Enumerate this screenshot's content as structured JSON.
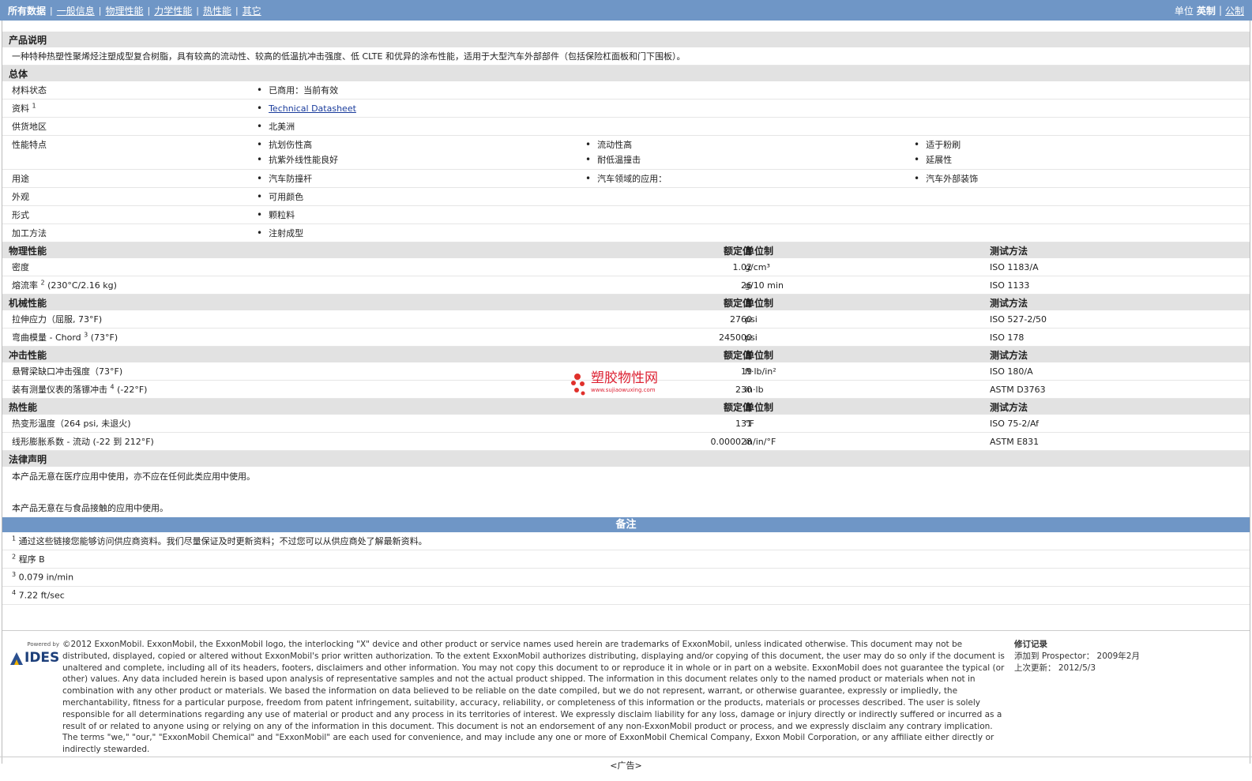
{
  "topbar": {
    "tabs": [
      "所有数据",
      "一般信息",
      "物理性能",
      "力学性能",
      "热性能",
      "其它"
    ],
    "unit_label": "单位",
    "unit_current": "英制",
    "unit_other": "公制"
  },
  "description": {
    "title": "产品说明",
    "text": "一种特种热塑性聚烯烃注塑成型复合树脂，具有较高的流动性、较高的低温抗冲击强度、低 CLTE 和优异的涂布性能，适用于大型汽车外部部件（包括保险杠面板和门下围板）。"
  },
  "general": {
    "title": "总体",
    "rows": [
      {
        "label": "材料状态",
        "items": [
          "已商用：当前有效"
        ]
      },
      {
        "label": "资料",
        "sup": "1",
        "items": [
          "Technical Datasheet"
        ]
      },
      {
        "label": "供货地区",
        "items": [
          "北美洲"
        ]
      },
      {
        "label": "性能特点",
        "items": [
          "抗划伤性高",
          "流动性高",
          "适于粉刷",
          "抗紫外线性能良好",
          "耐低温撞击",
          "延展性"
        ]
      },
      {
        "label": "用途",
        "items": [
          "汽车防撞杆",
          "汽车领域的应用：",
          "汽车外部装饰"
        ]
      },
      {
        "label": "外观",
        "items": [
          "可用颜色"
        ]
      },
      {
        "label": "形式",
        "items": [
          "颗粒料"
        ]
      },
      {
        "label": "加工方法",
        "items": [
          "注射成型"
        ]
      }
    ]
  },
  "headers": {
    "value": "额定值",
    "unit": "单位制",
    "test": "测试方法"
  },
  "physical": {
    "title": "物理性能",
    "rows": [
      {
        "name": "密度",
        "value": "1.02",
        "unit": "g/cm³",
        "test": "ISO 1183/A"
      },
      {
        "name": "熔流率",
        "sup": "2",
        "cond": " (230°C/2.16 kg)",
        "value": "26",
        "unit": "g/10 min",
        "test": "ISO 1133"
      }
    ]
  },
  "mechanical": {
    "title": "机械性能",
    "rows": [
      {
        "name": "拉伸应力（屈服, 73°F)",
        "value": "2760",
        "unit": "psi",
        "test": "ISO 527-2/50"
      },
      {
        "name": "弯曲模量 - Chord",
        "sup": "3",
        "cond": " (73°F)",
        "value": "245000",
        "unit": "psi",
        "test": "ISO 178"
      }
    ]
  },
  "impact": {
    "title": "冲击性能",
    "rows": [
      {
        "name": "悬臂梁缺口冲击强度（73°F)",
        "value": "19",
        "unit": "ft·lb/in²",
        "test": "ISO 180/A"
      },
      {
        "name": "装有测量仪表的落镖冲击",
        "sup": "4",
        "cond": " (-22°F)",
        "value": "230",
        "unit": "in·lb",
        "test": "ASTM D3763"
      }
    ]
  },
  "thermal": {
    "title": "热性能",
    "rows": [
      {
        "name": "热变形温度（264 psi, 未退火)",
        "value": "131",
        "unit": "°F",
        "test": "ISO 75-2/Af"
      },
      {
        "name": "线形膨胀系数 - 流动 (-22 到 212°F)",
        "value": "0.000028",
        "unit": "in/in/°F",
        "test": "ASTM E831"
      }
    ]
  },
  "legal": {
    "title": "法律声明",
    "p1": "本产品无意在医疗应用中使用，亦不应在任何此类应用中使用。",
    "p2": "本产品无意在与食品接触的应用中使用。"
  },
  "notes": {
    "title": "备注",
    "items": [
      {
        "n": "1",
        "text": "通过这些链接您能够访问供应商资料。我们尽量保证及时更新资料；不过您可以从供应商处了解最新资料。"
      },
      {
        "n": "2",
        "text": "程序 B"
      },
      {
        "n": "3",
        "text": "0.079 in/min"
      },
      {
        "n": "4",
        "text": "7.22 ft/sec"
      }
    ]
  },
  "footer": {
    "logo_top": "Powered by",
    "logo_text": "IDES",
    "copyright": "©2012 ExxonMobil. ExxonMobil, the ExxonMobil logo, the interlocking \"X\" device and other product or service names used herein are trademarks of ExxonMobil, unless indicated otherwise. This document may not be distributed, displayed, copied or altered without ExxonMobil's prior written authorization. To the extent ExxonMobil authorizes distributing, displaying and/or copying of this document, the user may do so only if the document is unaltered and complete, including all of its headers, footers, disclaimers and other information. You may not copy this document to or reproduce it in whole or in part on a website. ExxonMobil does not guarantee the typical (or other) values. Any data included herein is based upon analysis of representative samples and not the actual product shipped. The information in this document relates only to the named product or materials when not in combination with any other product or materials. We based the information on data believed to be reliable on the date compiled, but we do not represent, warrant, or otherwise guarantee, expressly or impliedly, the merchantability, fitness for a particular purpose, freedom from patent infringement, suitability, accuracy, reliability, or completeness of this information or the products, materials or processes described. The user is solely responsible for all determinations regarding any use of material or product and any process in its territories of interest. We expressly disclaim liability for any loss, damage or injury directly or indirectly suffered or incurred as a result of or related to anyone using or relying on any of the information in this document. This document is not an endorsement of any non-ExxonMobil product or process, and we expressly disclaim any contrary implication. The terms \"we,\" \"our,\" \"ExxonMobil Chemical\" and \"ExxonMobil\" are each used for convenience, and may include any one or more of ExxonMobil Chemical Company, Exxon Mobil Corporation, or any affiliate either directly or indirectly stewarded.",
    "rev_title": "修订记录",
    "rev_added": "添加到 Prospector： 2009年2月",
    "rev_updated": "上次更新： 2012/5/3"
  },
  "ad": "<广告>",
  "watermark": {
    "text": "塑胶物性网",
    "url": "www.sujiaowuxing.com"
  }
}
